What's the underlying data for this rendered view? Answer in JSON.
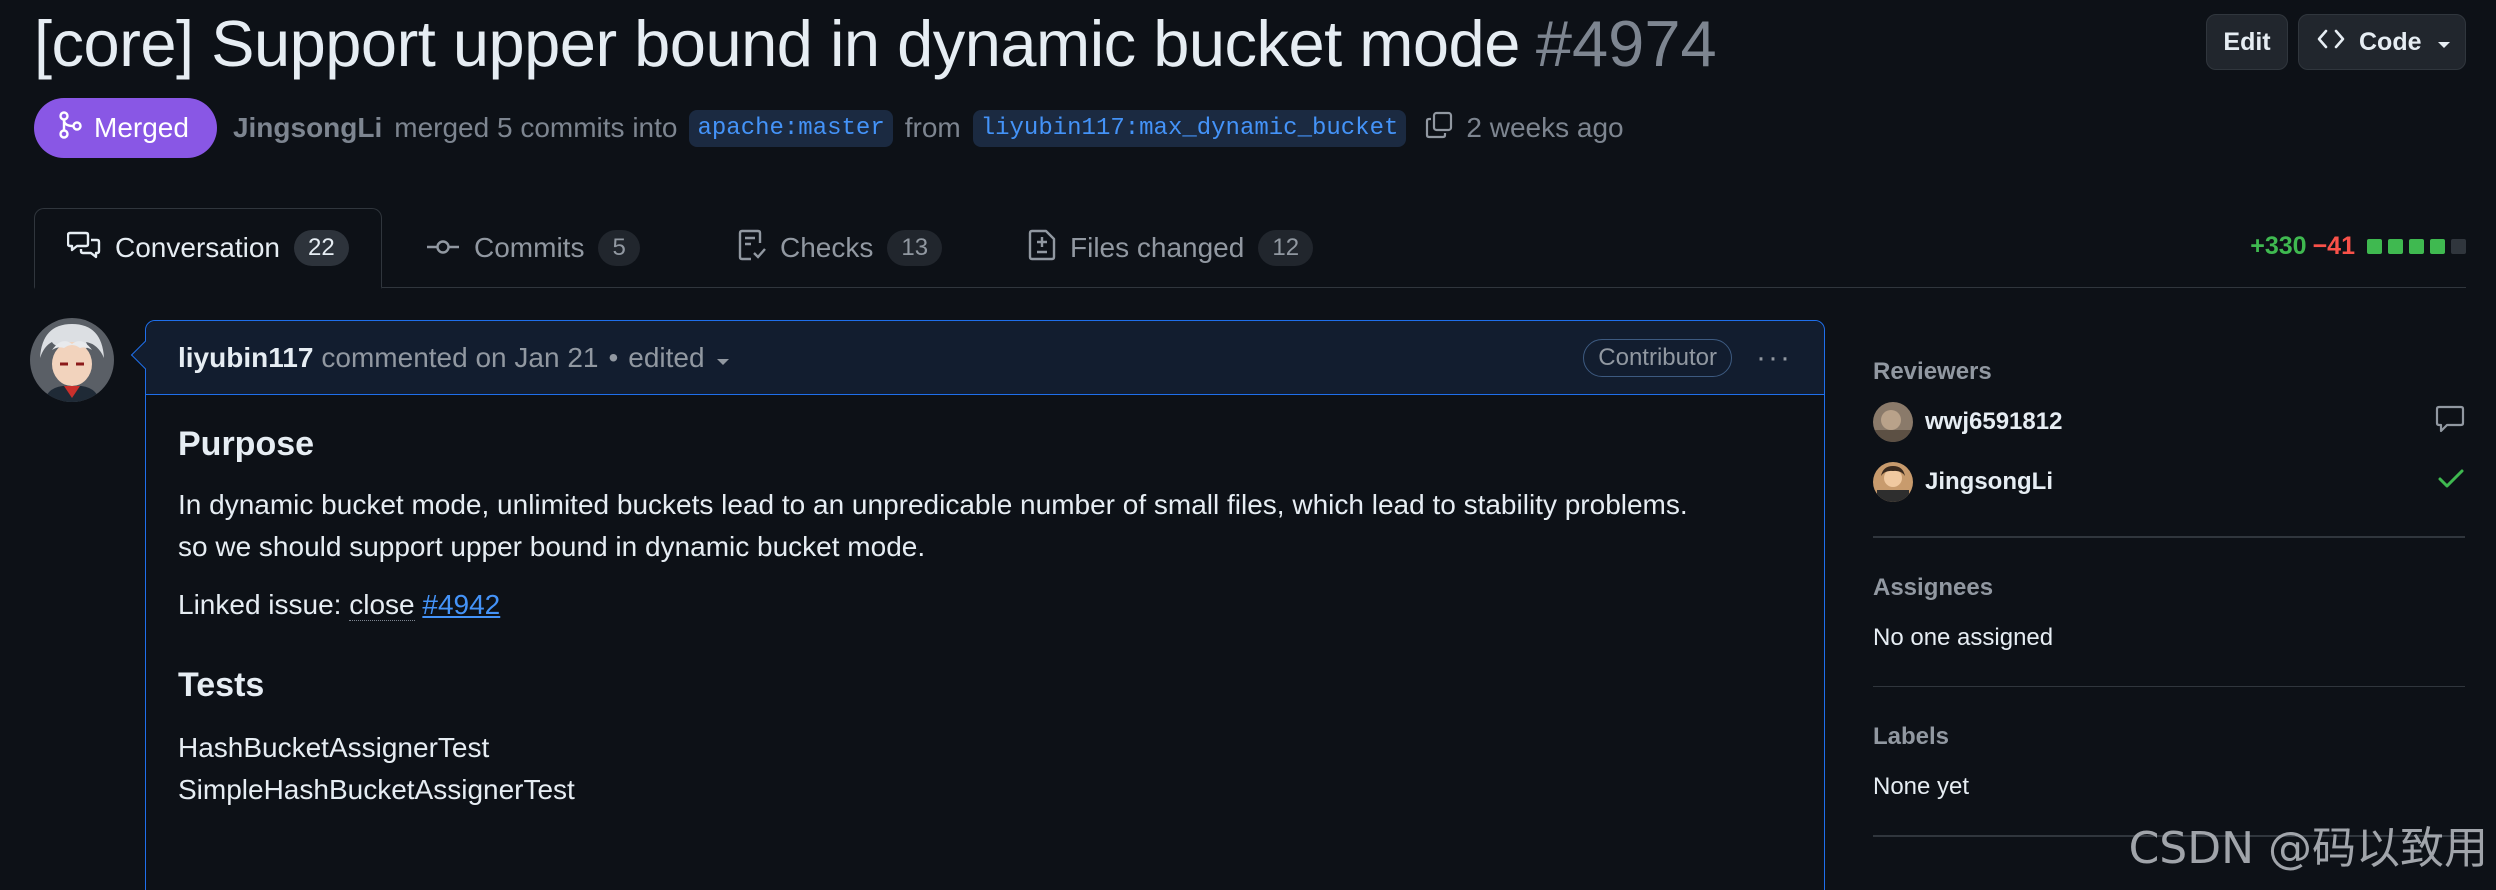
{
  "pr": {
    "title": "[core] Support upper bound in dynamic bucket mode",
    "number": "#4974"
  },
  "header_buttons": {
    "edit_label": "Edit",
    "code_label": "Code"
  },
  "meta": {
    "state": "Merged",
    "user": "JingsongLi",
    "action_text": "merged 5 commits into",
    "base_branch": "apache:master",
    "from_text": "from",
    "head_branch": "liyubin117:max_dynamic_bucket",
    "time": "2 weeks ago"
  },
  "tabs": [
    {
      "label": "Conversation",
      "count": "22",
      "icon": "conversation-icon"
    },
    {
      "label": "Commits",
      "count": "5",
      "icon": "commit-icon"
    },
    {
      "label": "Checks",
      "count": "13",
      "icon": "checklist-icon"
    },
    {
      "label": "Files changed",
      "count": "12",
      "icon": "file-diff-icon"
    }
  ],
  "diffstat": {
    "additions": "+330",
    "deletions": "−41",
    "colors": [
      "#3fb950",
      "#3fb950",
      "#3fb950",
      "#3fb950",
      "#30363d"
    ]
  },
  "comment": {
    "author": "liyubin117",
    "action": "commented on Jan 21",
    "edited": "edited",
    "role": "Contributor",
    "more": "···",
    "purpose_heading": "Purpose",
    "purpose_line1": "In dynamic bucket mode, unlimited buckets lead to an unpredicable number of small files, which lead to stability problems.",
    "purpose_line2": "so we should support upper bound in dynamic bucket mode.",
    "linked_prefix": "Linked issue:",
    "linked_close": "close",
    "linked_issue": "#4942",
    "tests_heading": "Tests",
    "tests": [
      "HashBucketAssignerTest",
      "SimpleHashBucketAssignerTest"
    ]
  },
  "sidebar": {
    "reviewers_title": "Reviewers",
    "reviewers": [
      {
        "name": "wwj6591812",
        "status_icon": "comment-icon"
      },
      {
        "name": "JingsongLi",
        "status_icon": "check-icon"
      }
    ],
    "assignees_title": "Assignees",
    "assignees_value": "No one assigned",
    "labels_title": "Labels",
    "labels_value": "None yet"
  },
  "watermark": "CSDN @码以致用",
  "colors": {
    "merged": "#8957e5",
    "link": "#4493f8",
    "addition": "#3fb950",
    "deletion": "#f85149",
    "background": "#0d1117"
  }
}
